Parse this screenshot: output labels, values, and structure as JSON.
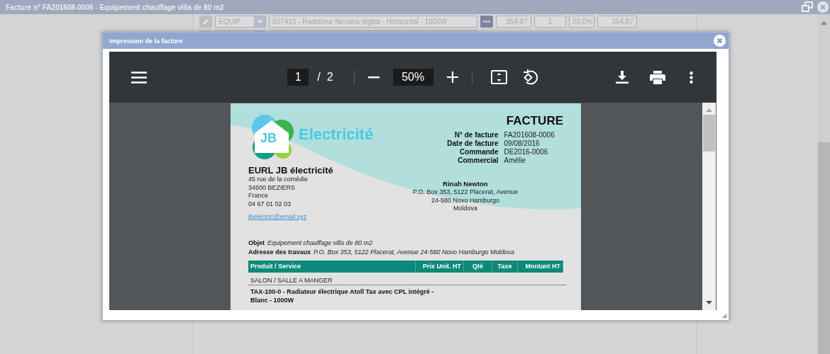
{
  "window": {
    "title": "Facture n° FA201608-0006 - Equipement chauffage villa de 80 m2"
  },
  "background_rows": [
    {
      "code": "EQUIP",
      "designation": "507410 - Radiateur Nirvana digital - Horizontal - 1000W",
      "price": "354,87",
      "qty": "1",
      "tax": "20,0%",
      "total": "354,87"
    }
  ],
  "dialog": {
    "title": "Impression de la facture"
  },
  "viewer": {
    "page": "1",
    "separator": "/",
    "page_count": "2",
    "zoom": "50%"
  },
  "document": {
    "logo_initials": "JB",
    "logo_text": "Electricité",
    "heading": "FACTURE",
    "info": [
      {
        "label": "N° de facture",
        "value": "FA201608-0006"
      },
      {
        "label": "Date de facture",
        "value": "09/08/2016"
      },
      {
        "label": "Commande",
        "value": "DE2016-0006"
      },
      {
        "label": "Commercial",
        "value": "Amélie"
      }
    ],
    "company": {
      "name": "EURL JB électricité",
      "lines": [
        "45 rue de la comédie",
        "34500 BEZIERS",
        "France",
        "04 67 01 02 03"
      ],
      "email": "jbelectric@email.xyz"
    },
    "client": {
      "name": "Rinah Newton",
      "lines": [
        "P.O. Box 353, 5122 Placerat, Avenue",
        "24-580 Novo Hamburgo",
        "Moldova"
      ]
    },
    "subject": {
      "label": "Objet",
      "value": "Equipement chauffage villa de 80 m2"
    },
    "site_address": {
      "label": "Adresse des travaux",
      "value": "P.O. Box 353, 5122 Placerat, Avenue 24-580 Novo Hamburgo Moldova"
    },
    "table": {
      "columns": [
        "Produit / Service",
        "Prix Unit. HT",
        "Qté",
        "Taxe",
        "Montant HT"
      ]
    },
    "section": "SALON / SALLE A MANGER",
    "item": "TAX-100-0 - Radiateur électrique Atoll Tax avec CPL intégré - Blanc - 1000W"
  }
}
